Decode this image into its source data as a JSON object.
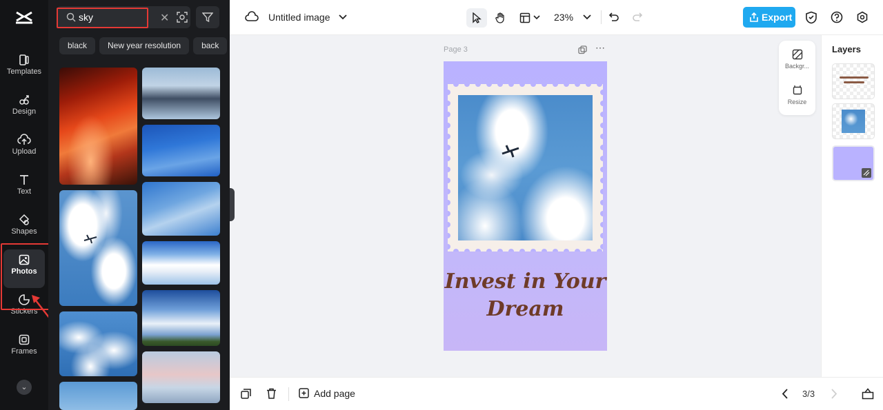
{
  "rail": {
    "items": [
      {
        "label": "Templates",
        "icon": "templates-icon"
      },
      {
        "label": "Design",
        "icon": "design-icon"
      },
      {
        "label": "Upload",
        "icon": "upload-icon"
      },
      {
        "label": "Text",
        "icon": "text-icon"
      },
      {
        "label": "Shapes",
        "icon": "shapes-icon"
      },
      {
        "label": "Photos",
        "icon": "photos-icon",
        "active": true
      },
      {
        "label": "Stickers",
        "icon": "stickers-icon"
      },
      {
        "label": "Frames",
        "icon": "frames-icon"
      }
    ]
  },
  "search": {
    "value": "sky",
    "placeholder": ""
  },
  "chips": [
    "black",
    "New year resolution",
    "back"
  ],
  "topbar": {
    "title": "Untitled image",
    "zoom": "23%",
    "export_label": "Export"
  },
  "canvas": {
    "page_label": "Page 3",
    "headline_line1": "Invest in Your",
    "headline_line2": "Dream",
    "float_panel": {
      "background_label": "Backgr...",
      "resize_label": "Resize"
    }
  },
  "layers": {
    "title": "Layers"
  },
  "bottombar": {
    "add_page_label": "Add page",
    "page_counter": "3/3"
  },
  "colors": {
    "accent": "#1fa9f0",
    "highlight": "#e53935",
    "page_bg": "#b9b2ff",
    "headline": "#6e3b28"
  }
}
